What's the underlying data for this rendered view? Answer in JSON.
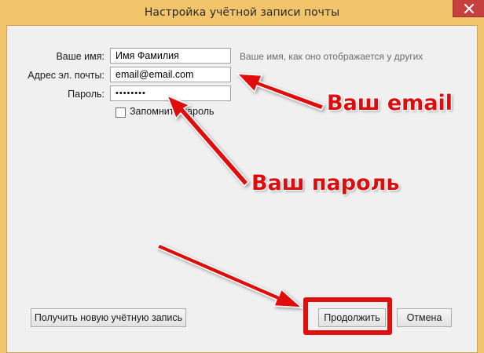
{
  "window": {
    "title": "Настройка учётной записи почты"
  },
  "form": {
    "name_label": "Ваше имя:",
    "name_value": "Имя Фамилия",
    "name_hint": "Ваше имя, как оно отображается у других",
    "email_label": "Адрес эл. почты:",
    "email_value": "email@email.com",
    "password_label": "Пароль:",
    "password_value": "••••••••",
    "remember_label": "Запомнить пароль",
    "remember_checked": false
  },
  "buttons": {
    "get_new_account": "Получить новую учётную запись",
    "continue": "Продолжить",
    "cancel": "Отмена"
  },
  "annotations": {
    "email": "Ваш email",
    "password": "Ваш пароль",
    "color": "#d90f0f"
  },
  "icons": {
    "close": "close-icon",
    "arrow": "arrow-icon"
  }
}
